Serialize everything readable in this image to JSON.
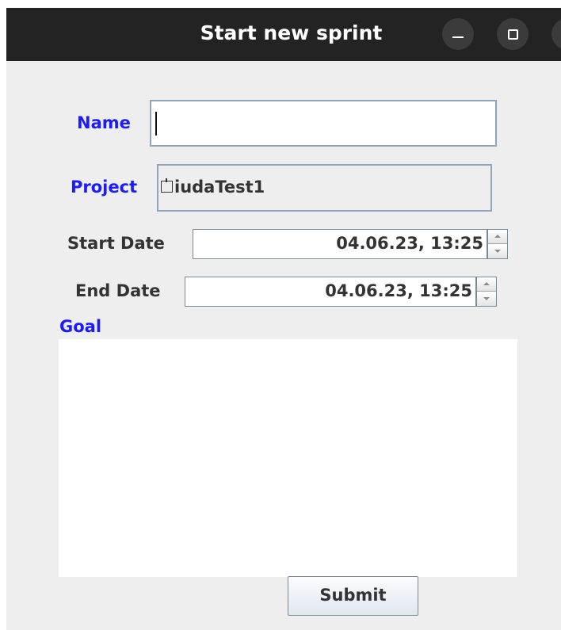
{
  "window": {
    "title": "Start new sprint",
    "controls": {
      "minimize_icon": "minimize-icon",
      "maximize_icon": "maximize-icon",
      "close_icon": "close-icon"
    }
  },
  "form": {
    "name": {
      "label": "Name",
      "value": ""
    },
    "project": {
      "label": "Project",
      "value": "iudaTest1"
    },
    "start_date": {
      "label": "Start Date",
      "value": "04.06.23, 13:25"
    },
    "end_date": {
      "label": "End Date",
      "value": "04.06.23, 13:25"
    },
    "goal": {
      "label": "Goal",
      "value": ""
    },
    "submit_label": "Submit"
  },
  "colors": {
    "required_label": "#1b1bff",
    "optional_label": "#333333",
    "titlebar": "#232323",
    "window_bg": "#eeeeee"
  }
}
